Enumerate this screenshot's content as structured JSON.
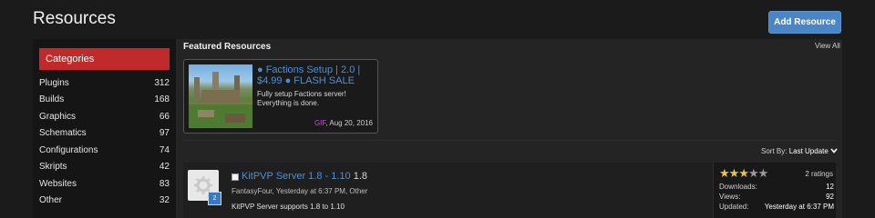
{
  "header": {
    "title": "Resources",
    "add_button": "Add Resource"
  },
  "sidebar": {
    "categories_label": "Categories",
    "items": [
      {
        "label": "Plugins",
        "count": "312"
      },
      {
        "label": "Builds",
        "count": "168"
      },
      {
        "label": "Graphics",
        "count": "66"
      },
      {
        "label": "Schematics",
        "count": "97"
      },
      {
        "label": "Configurations",
        "count": "74"
      },
      {
        "label": "Skripts",
        "count": "42"
      },
      {
        "label": "Websites",
        "count": "83"
      },
      {
        "label": "Other",
        "count": "32"
      }
    ]
  },
  "featured": {
    "title": "Featured Resources",
    "view_all": "View All",
    "card": {
      "name": "● Factions Setup | 2.0 | $4.99 ● FLASH SALE",
      "description": "Fully setup Factions server! Everything is done.",
      "tag": "GIF",
      "date": ", Aug 20, 2016"
    }
  },
  "sort": {
    "label": "Sort By:",
    "value": "Last Update"
  },
  "resources": [
    {
      "title": "KitPVP Server 1.8 - 1.10",
      "version": "1.8",
      "meta": "FantasyFour, Yesterday at 6:37 PM, Other",
      "description": "KitPVP Server supports 1.8 to 1.10",
      "badge": "2",
      "rating": 3,
      "ratings_text": "2 ratings",
      "downloads_label": "Downloads:",
      "downloads": "12",
      "views_label": "Views:",
      "views": "92",
      "updated_label": "Updated:",
      "updated": "Yesterday at 6:37 PM"
    }
  ],
  "colors": {
    "accent_blue": "#4a86c5",
    "category_red": "#c02a2a",
    "link_blue": "#4e8fd2",
    "gif_purple": "#b05bc0",
    "star_gold": "#e8c34a"
  }
}
